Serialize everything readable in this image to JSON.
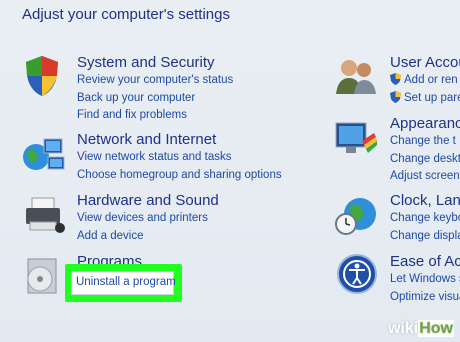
{
  "heading": "Adjust your computer's settings",
  "categories": {
    "system": {
      "title": "System and Security",
      "links": [
        "Review your computer's status",
        "Back up your computer",
        "Find and fix problems"
      ],
      "icon": "shield-icon"
    },
    "network": {
      "title": "Network and Internet",
      "links": [
        "View network status and tasks",
        "Choose homegroup and sharing options"
      ],
      "icon": "network-globe-icon"
    },
    "hardware": {
      "title": "Hardware and Sound",
      "links": [
        "View devices and printers",
        "Add a device"
      ],
      "icon": "printer-icon"
    },
    "programs": {
      "title": "Programs",
      "links": [
        "Uninstall a program"
      ],
      "icon": "programs-disc-icon"
    },
    "users": {
      "title": "User Accou",
      "links": [
        "Add or ren",
        "Set up pare"
      ],
      "icon": "users-icon"
    },
    "appearance": {
      "title": "Appearance",
      "links": [
        "Change the t",
        "Change deskto",
        "Adjust screen r"
      ],
      "icon": "monitor-paint-icon"
    },
    "clock": {
      "title": "Clock, Lang",
      "links": [
        "Change keybo",
        "Change display"
      ],
      "icon": "clock-globe-icon"
    },
    "ease": {
      "title": "Ease of Acc",
      "links": [
        "Let Windows s",
        "Optimize visua"
      ],
      "icon": "ease-of-access-icon"
    }
  },
  "highlight_color": "#21ff21",
  "watermark": {
    "wiki": "wiki",
    "how": "How"
  }
}
